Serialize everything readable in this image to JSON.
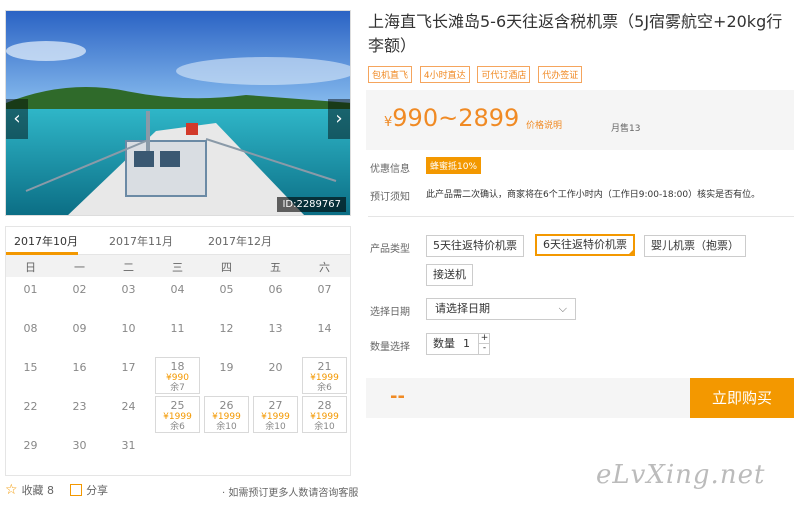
{
  "photo": {
    "id_label": "ID:2289767",
    "prev_glyph": "‹",
    "next_glyph": "›"
  },
  "calendar": {
    "tabs": [
      "2017年10月",
      "2017年11月",
      "2017年12月"
    ],
    "weekdays": [
      "日",
      "一",
      "二",
      "三",
      "四",
      "五",
      "六"
    ],
    "rows": [
      [
        {
          "d": "01"
        },
        {
          "d": "02"
        },
        {
          "d": "03"
        },
        {
          "d": "04"
        },
        {
          "d": "05"
        },
        {
          "d": "06"
        },
        {
          "d": "07"
        }
      ],
      [
        {
          "d": "08"
        },
        {
          "d": "09"
        },
        {
          "d": "10"
        },
        {
          "d": "11"
        },
        {
          "d": "12"
        },
        {
          "d": "13"
        },
        {
          "d": "14"
        }
      ],
      [
        {
          "d": "15"
        },
        {
          "d": "16"
        },
        {
          "d": "17"
        },
        {
          "d": "18",
          "p": "¥990",
          "r": "余7"
        },
        {
          "d": "19"
        },
        {
          "d": "20"
        },
        {
          "d": "21",
          "p": "¥1999",
          "r": "余6"
        }
      ],
      [
        {
          "d": "22"
        },
        {
          "d": "23"
        },
        {
          "d": "24"
        },
        {
          "d": "25",
          "p": "¥1999",
          "r": "余6"
        },
        {
          "d": "26",
          "p": "¥1999",
          "r": "余10"
        },
        {
          "d": "27",
          "p": "¥1999",
          "r": "余10"
        },
        {
          "d": "28",
          "p": "¥1999",
          "r": "余10"
        }
      ],
      [
        {
          "d": "29"
        },
        {
          "d": "30"
        },
        {
          "d": "31"
        }
      ]
    ]
  },
  "footer": {
    "favorite_label": "收藏 8",
    "share_label": "分享",
    "note": "· 如需预订更多人数请咨询客服"
  },
  "product": {
    "title": "上海直飞长滩岛5-6天往返含税机票（5J宿雾航空+20kg行李额）",
    "tags": [
      "包机直飞",
      "4小时直达",
      "可代订酒店",
      "代办签证"
    ],
    "price_symbol": "¥",
    "price_range": "990~2899",
    "price_note": "价格说明",
    "monthly_sales": "月售13",
    "promo_label": "优惠信息",
    "promo_badge": "蜂蜜抵10%",
    "notice_label": "预订须知",
    "notice_text": "此产品需二次确认，商家将在6个工作小时内（工作日9:00-18:00）核实是否有位。",
    "type_label": "产品类型",
    "types": [
      "5天往返特价机票",
      "6天往返特价机票",
      "婴儿机票（抱票）",
      "接送机"
    ],
    "date_label": "选择日期",
    "date_placeholder": "请选择日期",
    "qty_label": "数量选择",
    "qty_text": "数量",
    "qty_value": "1",
    "total_placeholder": "--",
    "buy_label": "立即购买"
  },
  "watermark": "eLvXing.net",
  "colors": {
    "accent": "#f39800",
    "price": "#f08a24"
  }
}
